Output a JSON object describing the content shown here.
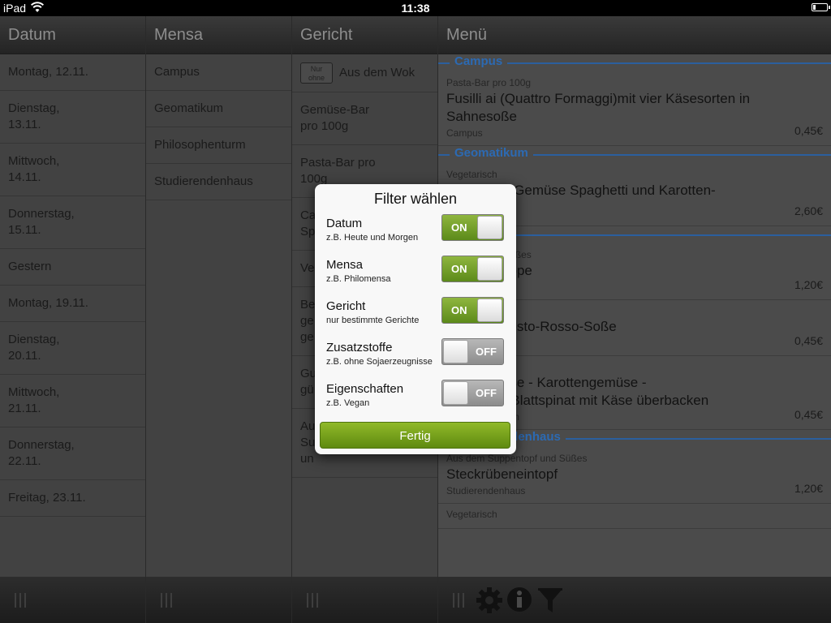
{
  "status": {
    "device": "iPad",
    "time": "11:38"
  },
  "columns": {
    "datum": {
      "header": "Datum",
      "items": [
        "Montag, 12.11.",
        "Dienstag,\n13.11.",
        "Mittwoch,\n14.11.",
        "Donnerstag,\n15.11.",
        "Gestern",
        "Montag, 19.11.",
        "Dienstag,\n20.11.",
        "Mittwoch,\n21.11.",
        "Donnerstag,\n22.11.",
        "Freitag, 23.11."
      ]
    },
    "mensa": {
      "header": "Mensa",
      "items": [
        "Campus",
        "Geomatikum",
        "Philosophenturm",
        "Studierendenhaus"
      ]
    },
    "gericht": {
      "header": "Gericht",
      "badge_top": "Nur",
      "badge_bottom": "ohne",
      "items": [
        "Aus dem Wok",
        "Gemüse-Bar\npro 100g",
        "Pasta-Bar pro\n100g",
        "Ca\nSp",
        "Ve",
        "Be\nge\nge",
        "Gu\ngü",
        "Au\nSu\nun"
      ]
    },
    "menu": {
      "header": "Menü",
      "sections": [
        {
          "title": "Campus",
          "items": [
            {
              "category": "Pasta-Bar pro 100g",
              "name": "Fusilli ai (Quattro Formaggi)mit vier Käsesorten in Sahnesoße",
              "location": "Campus",
              "price": "0,45€"
            }
          ]
        },
        {
          "title": "Geomatikum",
          "items": [
            {
              "category": "Vegetarisch",
              "name": "...nese mit Gemüse Spaghetti und Karotten-\n...lat",
              "location": "",
              "price": "2,60€"
            }
          ]
        },
        {
          "title": "...enturm",
          "items": [
            {
              "category": "...entopf und Süßes",
              "name": "...auch-Suppe",
              "location": "...m",
              "price": "1,20€"
            },
            {
              "category": "...100g",
              "name": "...kanter Pesto-Rosso-Soße",
              "location": "...m",
              "price": "0,45€"
            },
            {
              "category": "...ro 100g",
              "name": "...is-Gemüse - Karottengemüse -\n...öschen- Blattspinat mit Käse überbacken",
              "location": "Philosophenturm",
              "price": "0,45€"
            }
          ]
        },
        {
          "title": "Studierendenhaus",
          "items": [
            {
              "category": "Aus dem Suppentopf und Süßes",
              "name": "Steckrübeneintopf",
              "location": "Studierendenhaus",
              "price": "1,20€"
            },
            {
              "category": "Vegetarisch",
              "name": "",
              "location": "",
              "price": ""
            }
          ]
        }
      ]
    }
  },
  "popover": {
    "title": "Filter wählen",
    "filters": [
      {
        "label": "Datum",
        "hint": "z.B. Heute und Morgen",
        "state": "ON"
      },
      {
        "label": "Mensa",
        "hint": "z.B. Philomensa",
        "state": "ON"
      },
      {
        "label": "Gericht",
        "hint": "nur bestimmte Gerichte",
        "state": "ON"
      },
      {
        "label": "Zusatzstoffe",
        "hint": "z.B. ohne Sojaerzeugnisse",
        "state": "OFF"
      },
      {
        "label": "Eigenschaften",
        "hint": "z.B. Vegan",
        "state": "OFF"
      }
    ],
    "done_label": "Fertig"
  },
  "toolbar": {
    "icons": [
      "gear-icon",
      "info-icon",
      "filter-icon"
    ]
  },
  "colors": {
    "accent_blue": "#2c6ab3",
    "switch_on": "#7aa52d",
    "button_green": "#7aa51d"
  }
}
